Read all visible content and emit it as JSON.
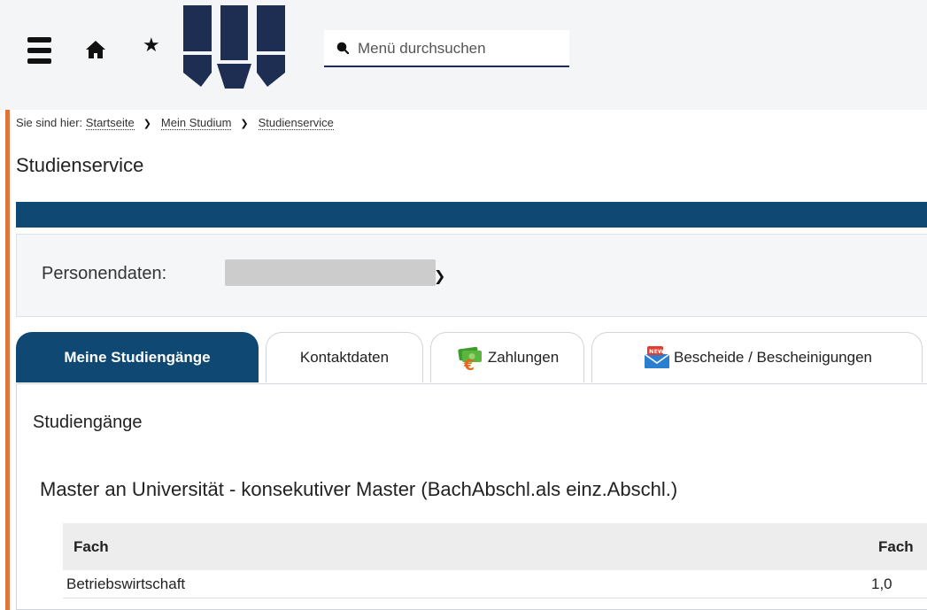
{
  "topbar": {
    "search_placeholder": "Menü durchsuchen",
    "icons": [
      "hamburger-menu-icon",
      "home-icon",
      "star-icon",
      "university-logo",
      "search-icon"
    ]
  },
  "breadcrumb": {
    "prefix": "Sie sind hier:",
    "items": [
      "Startseite",
      "Mein Studium",
      "Studienservice"
    ]
  },
  "page_title": "Studienservice",
  "person": {
    "label": "Personendaten:"
  },
  "tabs": [
    {
      "label": "Meine Studiengänge",
      "active": true
    },
    {
      "label": "Kontaktdaten",
      "active": false
    },
    {
      "label": "Zahlungen",
      "active": false,
      "icon": "money-icon"
    },
    {
      "label": "Bescheide / Bescheinigungen",
      "active": false,
      "icon": "new-mail-icon"
    }
  ],
  "content": {
    "section_title": "Studiengänge",
    "program_title": "Master an Universität - konsekutiver Master (BachAbschl.als einz.Abschl.)",
    "table": {
      "headers": [
        "Fach",
        "Fach"
      ],
      "rows": [
        [
          "Betriebswirtschaft",
          "1,0"
        ]
      ]
    }
  },
  "colors": {
    "primary": "#0e4873",
    "accent": "#e0733a",
    "logo": "#1e2e52"
  }
}
